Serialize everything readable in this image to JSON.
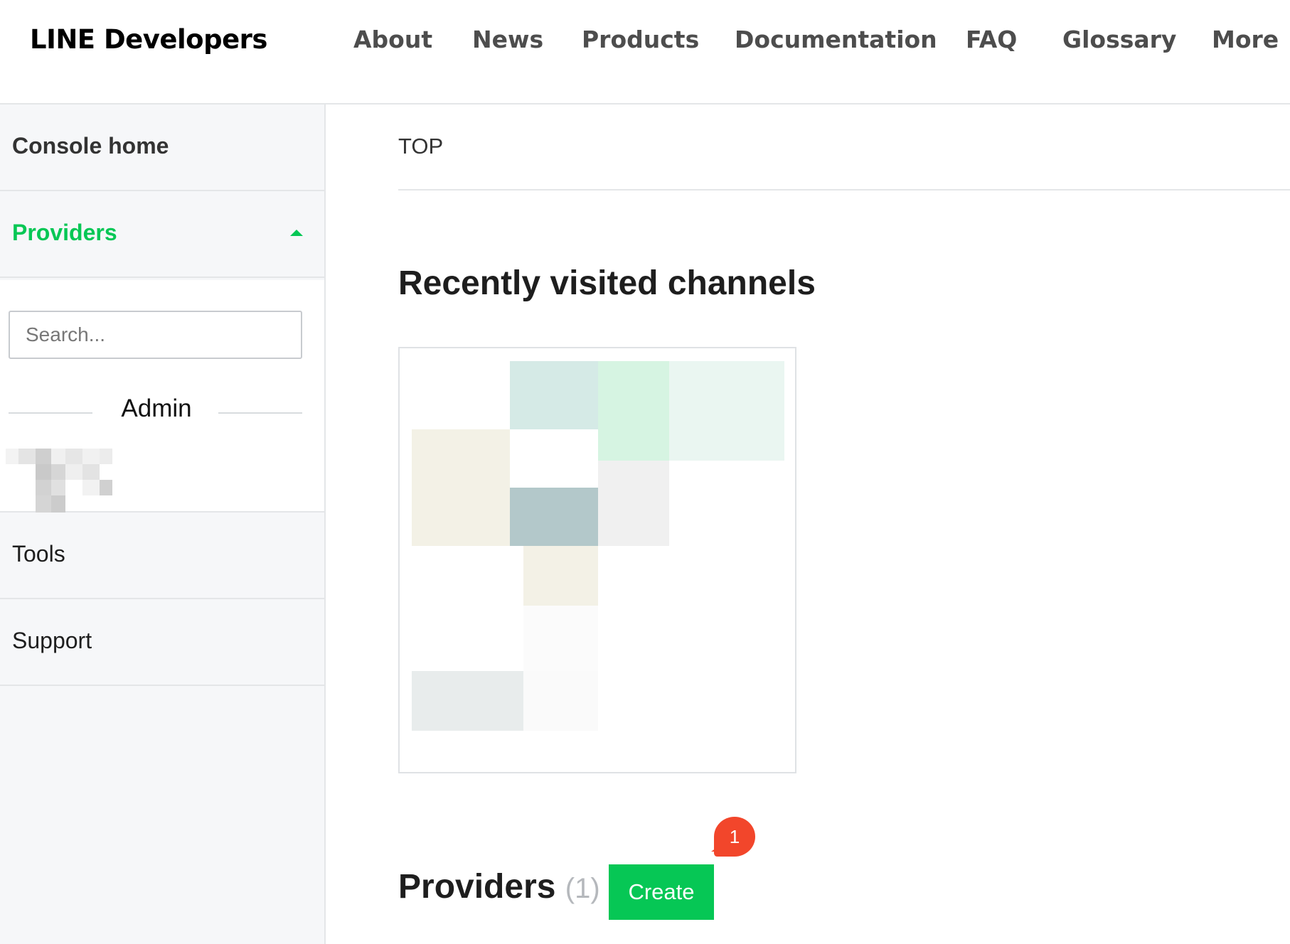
{
  "header": {
    "logo": "LINE Developers",
    "nav": [
      "About",
      "News",
      "Products",
      "Documentation",
      "FAQ",
      "Glossary",
      "More"
    ]
  },
  "sidebar": {
    "console_home": "Console home",
    "providers": "Providers",
    "search_placeholder": "Search...",
    "admin_label": "Admin",
    "tools": "Tools",
    "support": "Support"
  },
  "main": {
    "breadcrumb": "TOP",
    "recent_title": "Recently visited channels",
    "providers_title": "Providers",
    "providers_count": "(1)",
    "create_label": "Create",
    "badge": "1"
  },
  "colors": {
    "accent_green": "#06c755",
    "badge_red": "#f2462b"
  }
}
